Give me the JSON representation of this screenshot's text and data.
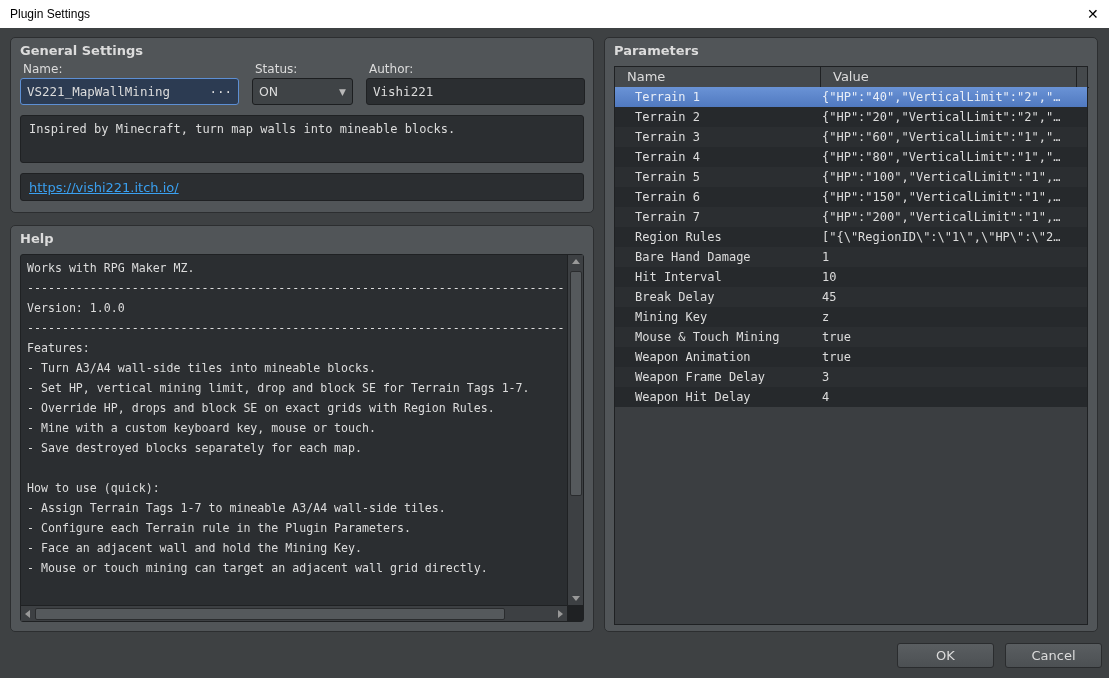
{
  "window": {
    "title": "Plugin Settings",
    "close": "✕"
  },
  "general": {
    "heading": "General Settings",
    "name_label": "Name:",
    "name_value": "VS221_MapWallMining",
    "name_focused": true,
    "browse_button": "···",
    "status_label": "Status:",
    "status_value": "ON",
    "status_caret": "▼",
    "author_label": "Author:",
    "author_value": "Vishi221",
    "description": "Inspired by Minecraft, turn map walls into mineable blocks.",
    "link": "https://vishi221.itch.io/"
  },
  "help": {
    "heading": "Help",
    "paragraphs": [
      [
        "Works with RPG Maker MZ.",
        "-----------------------------------------------------------------------------",
        "Version: 1.0.0",
        "-----------------------------------------------------------------------------",
        "Features:",
        "- Turn A3/A4 wall-side tiles into mineable blocks.",
        "- Set HP, vertical mining limit, drop and block SE for Terrain Tags 1-7.",
        "- Override HP, drops and block SE on exact grids with Region Rules.",
        "- Mine with a custom keyboard key, mouse or touch.",
        "- Save destroyed blocks separately for each map."
      ],
      [
        "How to use (quick):",
        "- Assign Terrain Tags 1-7 to mineable A3/A4 wall-side tiles.",
        "- Configure each Terrain rule in the Plugin Parameters.",
        "- Face an adjacent wall and hold the Mining Key.",
        "- Mouse or touch mining can target an adjacent wall grid directly."
      ]
    ]
  },
  "parameters": {
    "heading": "Parameters",
    "columns": [
      "Name",
      "Value"
    ],
    "rows": [
      {
        "name": "Terrain 1",
        "value": "{\"HP\":\"40\",\"VerticalLimit\":\"2\",\"…",
        "selected": true
      },
      {
        "name": "Terrain 2",
        "value": "{\"HP\":\"20\",\"VerticalLimit\":\"2\",\"…",
        "selected": false
      },
      {
        "name": "Terrain 3",
        "value": "{\"HP\":\"60\",\"VerticalLimit\":\"1\",\"…",
        "selected": false
      },
      {
        "name": "Terrain 4",
        "value": "{\"HP\":\"80\",\"VerticalLimit\":\"1\",\"…",
        "selected": false
      },
      {
        "name": "Terrain 5",
        "value": "{\"HP\":\"100\",\"VerticalLimit\":\"1\",…",
        "selected": false
      },
      {
        "name": "Terrain 6",
        "value": "{\"HP\":\"150\",\"VerticalLimit\":\"1\",…",
        "selected": false
      },
      {
        "name": "Terrain 7",
        "value": "{\"HP\":\"200\",\"VerticalLimit\":\"1\",…",
        "selected": false
      },
      {
        "name": "Region Rules",
        "value": "[\"{\\\"RegionID\\\":\\\"1\\\",\\\"HP\\\":\\\"2…",
        "selected": false
      },
      {
        "name": "Bare Hand Damage",
        "value": "1",
        "selected": false
      },
      {
        "name": "Hit Interval",
        "value": "10",
        "selected": false
      },
      {
        "name": "Break Delay",
        "value": "45",
        "selected": false
      },
      {
        "name": "Mining Key",
        "value": "z",
        "selected": false
      },
      {
        "name": "Mouse & Touch Mining",
        "value": "true",
        "selected": false
      },
      {
        "name": "Weapon Animation",
        "value": "true",
        "selected": false
      },
      {
        "name": "Weapon Frame Delay",
        "value": "3",
        "selected": false
      },
      {
        "name": "Weapon Hit Delay",
        "value": "4",
        "selected": false
      }
    ]
  },
  "buttons": [
    "OK",
    "Cancel"
  ]
}
